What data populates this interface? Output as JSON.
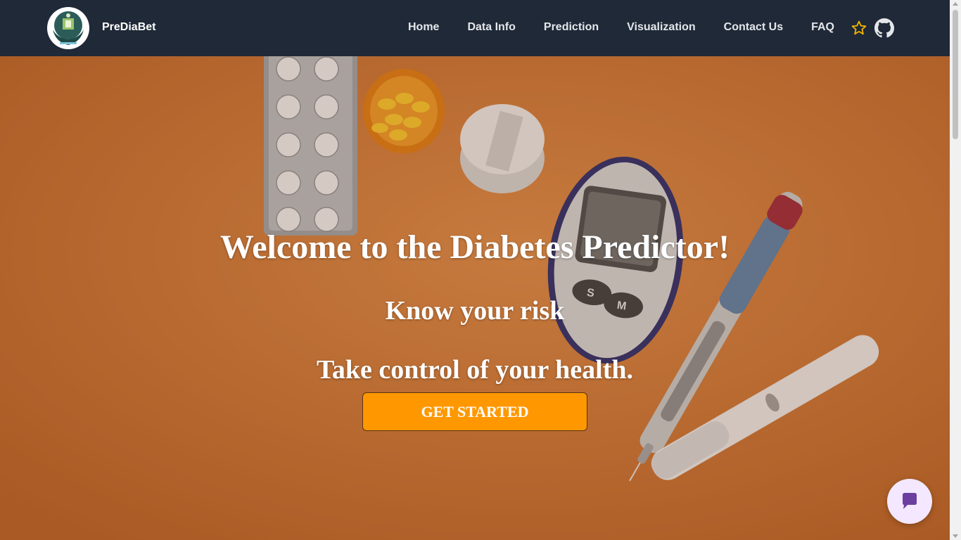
{
  "brand": {
    "name": "PreDiaBet",
    "logo_icon": "health-hands-logo"
  },
  "nav": {
    "items": [
      {
        "label": "Home"
      },
      {
        "label": "Data Info"
      },
      {
        "label": "Prediction"
      },
      {
        "label": "Visualization"
      },
      {
        "label": "Contact Us"
      },
      {
        "label": "FAQ"
      }
    ],
    "star_icon": "star-icon",
    "github_icon": "github-icon"
  },
  "hero": {
    "title": "Welcome to the Diabetes Predictor!",
    "subtitle1": "Know your risk",
    "subtitle2": "Take control of your health.",
    "cta_label": "GET STARTED",
    "background_description_icon": "diabetes-supplies-photo"
  },
  "chat": {
    "icon": "chat-icon"
  },
  "colors": {
    "navbar_bg": "#1f2937",
    "cta_bg": "#ff9800",
    "star": "#f5b400",
    "chat_bg": "#f3e8ff",
    "chat_icon": "#6b3fa0"
  }
}
